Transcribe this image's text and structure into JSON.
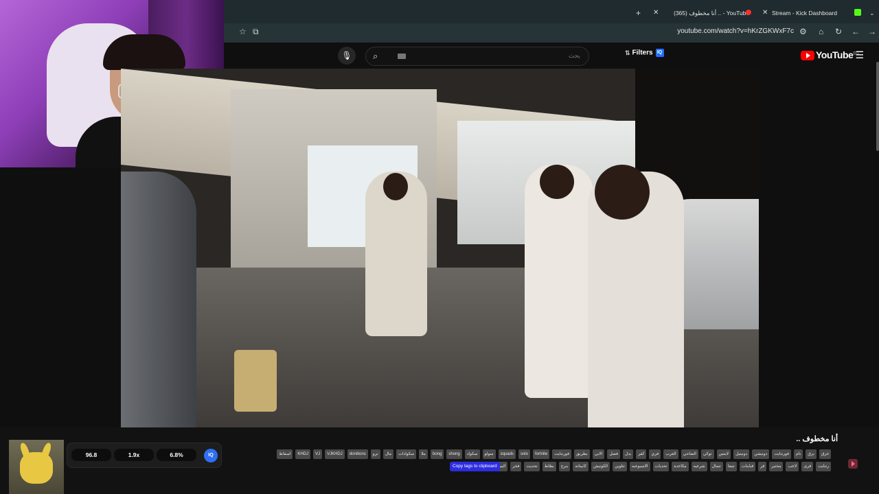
{
  "browser": {
    "new_tab_label": "+",
    "tabs": [
      {
        "label": "(365) أنا مخطوف .. - YouTube"
      },
      {
        "label": "Stream - Kick Dashboard"
      }
    ],
    "close_glyph": "✕",
    "chevron_glyph": "⌄",
    "url": "youtube.com/watch?v=hKrZGKWxF7c",
    "colors": {
      "tabstrip": "#1f2b2e",
      "toolbar": "#273437",
      "kick": "#53fc18"
    }
  },
  "youtube": {
    "search_placeholder": "بحث",
    "filters_label": "Filters",
    "filters_badge": "IQ",
    "logo_text": "YouTube",
    "logo_country": "EG",
    "accent": "#ff0000"
  },
  "video_info": {
    "title": "أنا مخطوف ..",
    "copy_tags_label": "Copy tags to clipboard",
    "tags_row1": [
      "غرق",
      "برق",
      "نام",
      "فورتنايت",
      "دونيشن",
      "دونيتيل",
      "لايتس",
      "توكي",
      "الضاحي",
      "العرب",
      "فري",
      "كفر",
      "بدل",
      "فصل",
      "الابي",
      "بطريق",
      "فورتنايت",
      "fortnite",
      "solo",
      "squads",
      "سولو",
      "سكواد",
      "shong",
      "bong",
      "ملا",
      "سكوادات",
      "مال",
      "ترو",
      "donitions",
      "VJKHDJ",
      "VJ",
      "KHDJ",
      "اسقاط"
    ],
    "tags_row2": [
      "رتنايت",
      "قرى",
      "لاعب",
      "مختبر",
      "قر",
      "قبابنات",
      "تتبعا",
      "تتمال",
      "شرعيه",
      "مكاعدة",
      "تحديات",
      "الاسبوعيه",
      "تتلوين",
      "الكوتيش",
      "كابيتانه",
      "بنرج",
      "بطاط",
      "تحديث",
      "فخر",
      "المبرلين"
    ]
  },
  "stats": {
    "values": [
      "96.8",
      "1.9x",
      "6.8%"
    ],
    "badge": "IQ"
  }
}
